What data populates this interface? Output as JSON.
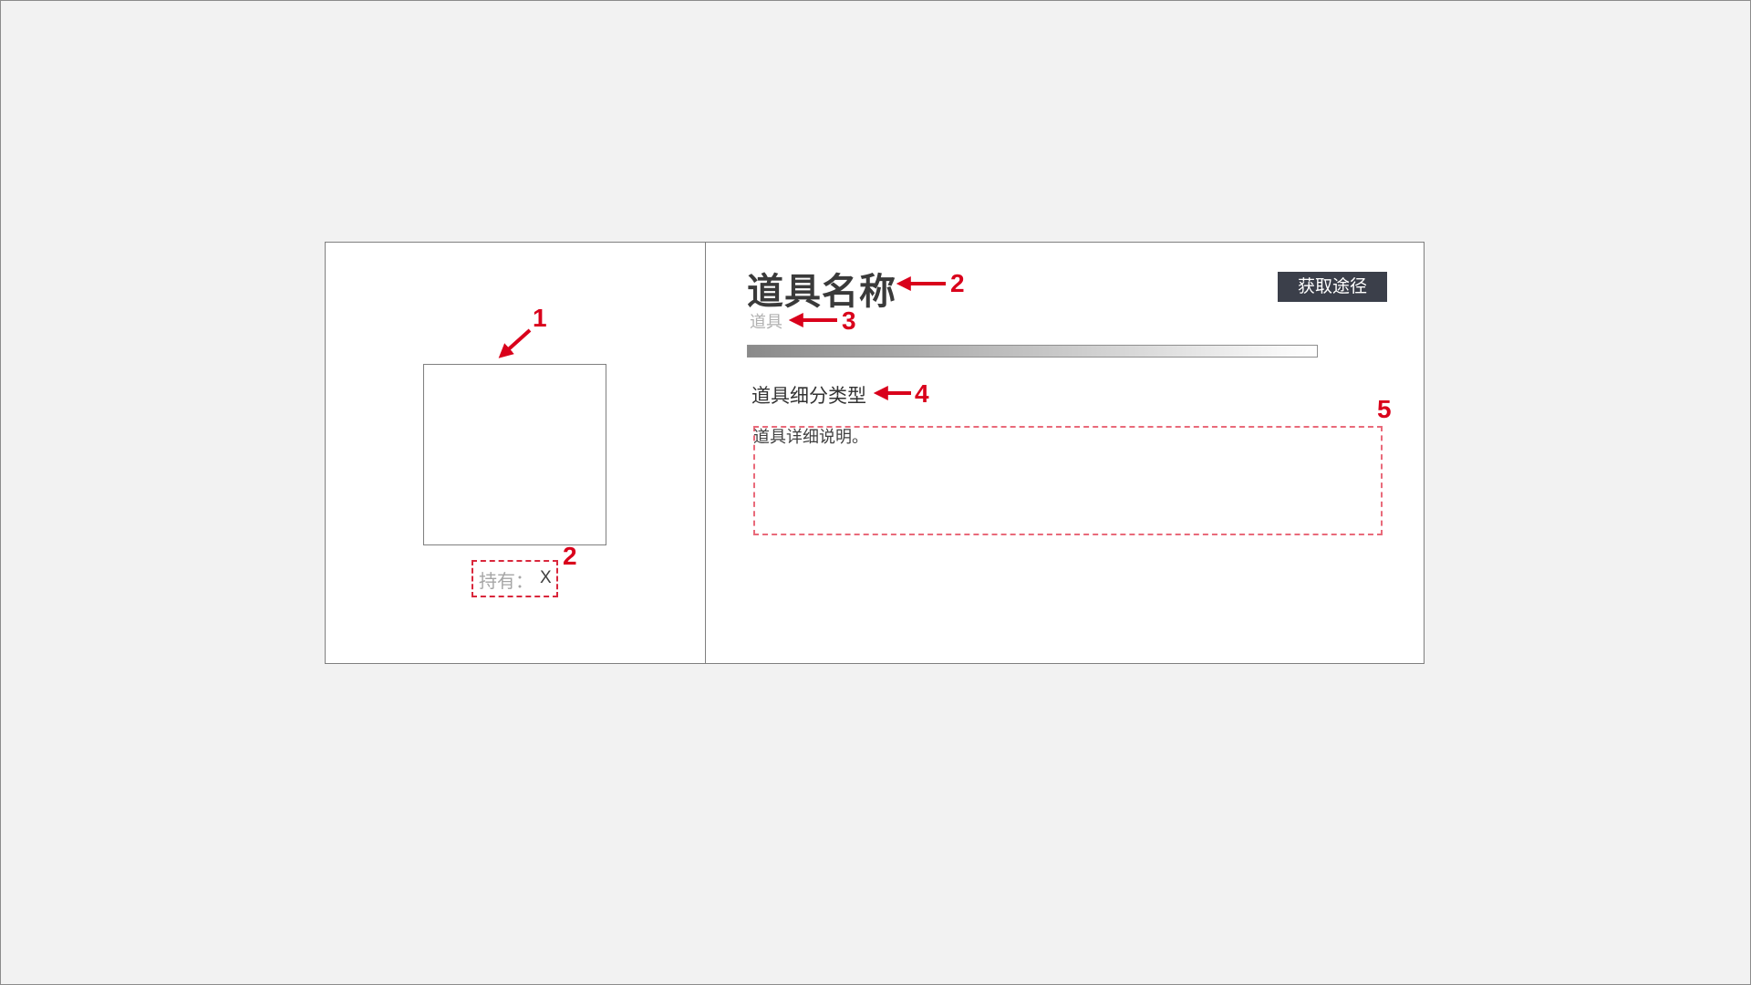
{
  "left_panel": {
    "owned_label": "持有：",
    "owned_value": "X"
  },
  "right_panel": {
    "item_name": "道具名称",
    "item_category": "道具",
    "acquire_button": "获取途径",
    "item_subtype": "道具细分类型",
    "description": "道具详细说明。"
  },
  "annotations": {
    "m1": "1",
    "m2_owned": "2",
    "m2_name": "2",
    "m3": "3",
    "m4": "4",
    "m5": "5",
    "marker_color": "#d9001b"
  }
}
